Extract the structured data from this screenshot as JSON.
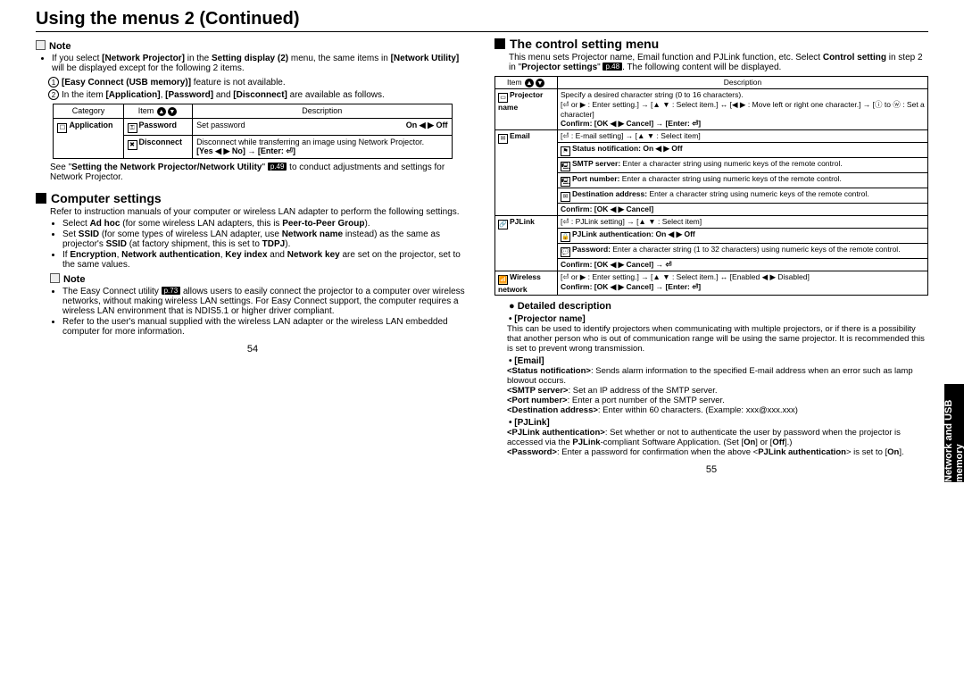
{
  "title": "Using the menus 2 (Continued)",
  "side_tab": "Network and USB memory",
  "left": {
    "note1_label": "Note",
    "note1_b1a": "If you select ",
    "note1_b1b": "[Network Projector]",
    "note1_b1c": " in the ",
    "note1_b1d": "Setting display (2)",
    "note1_b1e": " menu, the same items in ",
    "note1_b1f": "[Network Utility]",
    "note1_b1g": " will be displayed except for the following 2 items.",
    "c1a": "[Easy Connect (USB memory)]",
    "c1b": " feature is not available.",
    "c2a": "In the item ",
    "c2b": "[Application]",
    "c2c": ", ",
    "c2d": "[Password]",
    "c2e": " and ",
    "c2f": "[Disconnect]",
    "c2g": " are available as follows.",
    "table1": {
      "h_cat": "Category",
      "h_item": "Item",
      "h_desc": "Description",
      "r1_cat": "Application",
      "r1_item": "Password",
      "r1_desc": "Set password",
      "r1_opt": "On ◀ ▶ Off",
      "r2_item": "Disconnect",
      "r2_desc": "Disconnect while transferring an image using Network Projector.",
      "r2_opt": "[Yes ◀ ▶ No] → [Enter: ⏎]"
    },
    "see_a": "See \"",
    "see_b": "Setting the Network Projector/Network Utility",
    "see_c": "\" ",
    "see_ref": "p.49",
    "see_d": " to conduct adjustments and settings for Network Projector.",
    "sec_comp": "Computer settings",
    "comp_intro": "Refer to instruction manuals of your computer or wireless LAN adapter to perform the following settings.",
    "comp_b1a": "Select ",
    "comp_b1b": "Ad hoc",
    "comp_b1c": " (for some wireless  LAN adapters, this is ",
    "comp_b1d": "Peer-to-Peer Group",
    "comp_b1e": ").",
    "comp_b2a": "Set ",
    "comp_b2b": "SSID",
    "comp_b2c": " (for some types of wireless LAN adapter, use ",
    "comp_b2d": "Network name",
    "comp_b2e": " instead) as the same as projector's ",
    "comp_b2f": "SSID",
    "comp_b2g": " (at factory shipment, this is set to ",
    "comp_b2h": "TDPJ",
    "comp_b2i": ").",
    "comp_b3a": "If ",
    "comp_b3b": "Encryption",
    "comp_b3c": ", ",
    "comp_b3d": "Network authentication",
    "comp_b3e": ", ",
    "comp_b3f": "Key index",
    "comp_b3g": " and ",
    "comp_b3h": "Network key",
    "comp_b3i": " are set on the projector, set to the same values.",
    "note2_label": "Note",
    "note2_b1a": "The Easy Connect utility ",
    "note2_ref": "p.73",
    "note2_b1b": " allows users to easily connect the projector to a computer over wireless networks, without making wireless LAN settings. For Easy Connect support, the computer requires a wireless LAN environment that is NDIS5.1 or higher driver compliant.",
    "note2_b2": "Refer to the user's manual supplied with the wireless LAN adapter or the wireless LAN embedded computer for more information.",
    "page": "54"
  },
  "right": {
    "sec_ctrl": "The control setting menu",
    "ctrl_intro_a": "This menu sets Projector name, Email function and PJLink function, etc. Select ",
    "ctrl_intro_b": "Control setting",
    "ctrl_intro_c": " in step 2 in \"",
    "ctrl_intro_d": "Projector settings",
    "ctrl_intro_e": "\" ",
    "ctrl_ref": "p.48",
    "ctrl_intro_f": ". The following content will be displayed.",
    "tbl": {
      "h_item": "Item",
      "h_desc": "Description",
      "r_proj_item": "Projector name",
      "r_proj_d1": "Specify a desired character string (0 to 16 characters).",
      "r_proj_d2": "[⏎ or ▶ : Enter setting.] → [▲ ▼ : Select item.] ↔ [◀ ▶ : Move left or right one character.] → [ⓘ to ⓦ : Set a character]",
      "r_proj_d3": "Confirm: [OK ◀ ▶ Cancel] → [Enter: ⏎]",
      "r_email_item": "Email",
      "r_email_d1": "[⏎ : E-mail setting] → [▲ ▼ : Select item]",
      "r_email_d2": "Status notification: On ◀ ▶ Off",
      "r_email_d3a": "SMTP server:",
      "r_email_d3b": " Enter a character string using numeric keys of the remote control.",
      "r_email_d4a": "Port number:",
      "r_email_d4b": " Enter a character string using numeric keys of the remote control.",
      "r_email_d5a": "Destination address:",
      "r_email_d5b": " Enter a character string using numeric keys of the remote control.",
      "r_email_d6": "Confirm:     [OK ◀ ▶ Cancel]",
      "r_pj_item": "PJLink",
      "r_pj_d1": "[⏎ : PJLink setting] → [▲ ▼ : Select item]",
      "r_pj_d2": "PJLink authentication: On ◀ ▶ Off",
      "r_pj_d3a": "Password:",
      "r_pj_d3b": "  Enter a character string (1 to 32 characters) using numeric keys of the remote control.",
      "r_pj_d4": "Confirm: [OK ◀ ▶ Cancel] → ⏎",
      "r_wl_item": "Wireless network",
      "r_wl_d1": "[⏎ or ▶ : Enter setting.] → [▲ ▼ : Select item.] ↔ [Enabled ◀ ▶ Disabled]",
      "r_wl_d2": "Confirm: [OK ◀ ▶ Cancel] → [Enter: ⏎]"
    },
    "det_hdr": "Detailed description",
    "det_proj_t": "[Projector name]",
    "det_proj_b": "This can be used to identify projectors when communicating with multiple projectors, or if there is a possibility that another person who is out of communication range will be using the same projector. It is recommended this is set to prevent wrong transmission.",
    "det_email_t": "[Email]",
    "det_email_b1a": "<Status notification>",
    "det_email_b1b": ": Sends alarm information to the specified E-mail address when an error such as lamp blowout occurs.",
    "det_email_b2a": "<SMTP server>",
    "det_email_b2b": ": Set an IP address of the SMTP server.",
    "det_email_b3a": "<Port number>",
    "det_email_b3b": ": Enter a port number of the SMTP server.",
    "det_email_b4a": "<Destination address>",
    "det_email_b4b": ": Enter within 60 characters. (Example: xxx@xxx.xxx)",
    "det_pj_t": "[PJLink]",
    "det_pj_b1a": "<PJLink authentication>",
    "det_pj_b1b": ": Set whether or not to authenticate the user by password when the projector is accessed via the ",
    "det_pj_b1c": "PJLink",
    "det_pj_b1d": "-compliant Software Application. (Set [",
    "det_pj_b1e": "On",
    "det_pj_b1f": "] or [",
    "det_pj_b1g": "Off",
    "det_pj_b1h": "].)",
    "det_pj_b2a": "<Password>",
    "det_pj_b2b": ": Enter a password for confirmation when the above <",
    "det_pj_b2c": "PJLink authentication",
    "det_pj_b2d": "> is set to [",
    "det_pj_b2e": "On",
    "det_pj_b2f": "].",
    "page": "55"
  }
}
